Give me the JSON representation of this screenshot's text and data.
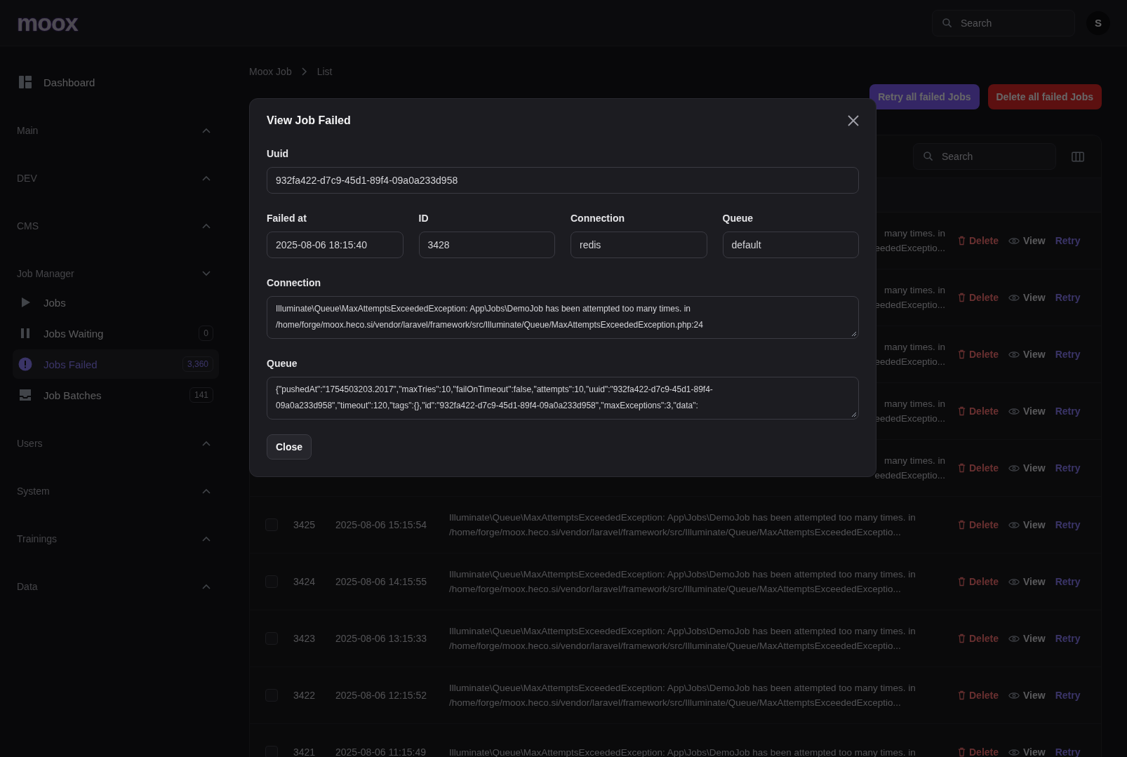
{
  "topbar": {
    "logo": "moox",
    "search": {
      "placeholder": "Search"
    },
    "avatar": "S"
  },
  "sidebar": {
    "items": [
      {
        "kind": "link",
        "label": "Dashboard",
        "selected": false
      },
      {
        "kind": "group",
        "label": "Main",
        "expanded": false
      },
      {
        "kind": "group",
        "label": "DEV",
        "expanded": false
      },
      {
        "kind": "group",
        "label": "CMS",
        "expanded": false
      },
      {
        "kind": "group",
        "label": "Job Manager",
        "expanded": true,
        "children": [
          {
            "label": "Jobs",
            "selected": false
          },
          {
            "label": "Jobs Waiting",
            "badge": "0",
            "selected": false
          },
          {
            "label": "Jobs Failed",
            "badge": "3,360",
            "selected": true
          },
          {
            "label": "Job Batches",
            "badge": "141",
            "selected": false
          }
        ]
      },
      {
        "kind": "group",
        "label": "Users",
        "expanded": false
      },
      {
        "kind": "group",
        "label": "System",
        "expanded": false
      },
      {
        "kind": "group",
        "label": "Trainings",
        "expanded": false
      },
      {
        "kind": "group",
        "label": "Data",
        "expanded": false
      }
    ]
  },
  "breadcrumbs": [
    "Moox Job",
    "List"
  ],
  "header_actions": [
    {
      "label": "Retry all failed Jobs",
      "kind": "primary"
    },
    {
      "label": "Delete all failed Jobs",
      "kind": "danger"
    }
  ],
  "table": {
    "search": {
      "placeholder": "Search"
    },
    "rows": [
      {
        "message": [
          "many times. in",
          "eededExceptio..."
        ],
        "actions": [
          {
            "label": "Delete",
            "kind": "delete"
          },
          {
            "label": "View",
            "kind": "view"
          },
          {
            "label": "Retry",
            "kind": "retry"
          }
        ]
      },
      {
        "message": [
          "many times. in",
          "eededExceptio..."
        ],
        "actions": [
          {
            "label": "Delete",
            "kind": "delete"
          },
          {
            "label": "View",
            "kind": "view"
          },
          {
            "label": "Retry",
            "kind": "retry"
          }
        ]
      },
      {
        "message": [
          "many times. in",
          "eededExceptio..."
        ],
        "actions": [
          {
            "label": "Delete",
            "kind": "delete"
          },
          {
            "label": "View",
            "kind": "view"
          },
          {
            "label": "Retry",
            "kind": "retry"
          }
        ]
      },
      {
        "message": [
          "many times. in",
          "eededExceptio..."
        ],
        "actions": [
          {
            "label": "Delete",
            "kind": "delete"
          },
          {
            "label": "View",
            "kind": "view"
          },
          {
            "label": "Retry",
            "kind": "retry"
          }
        ]
      },
      {
        "message": [
          "many times. in",
          "eededExceptio..."
        ],
        "actions": [
          {
            "label": "Delete",
            "kind": "delete"
          },
          {
            "label": "View",
            "kind": "view"
          },
          {
            "label": "Retry",
            "kind": "retry"
          }
        ]
      },
      {
        "selected": false,
        "id": "3425",
        "failed_at": "2025-08-06 15:15:54",
        "message": [
          "Illuminate\\Queue\\MaxAttemptsExceededException: App\\Jobs\\DemoJob has been attempted too many times. in",
          "/home/forge/moox.heco.si/vendor/laravel/framework/src/Illuminate/Queue/MaxAttemptsExceededExceptio..."
        ],
        "actions": [
          {
            "label": "Delete",
            "kind": "delete"
          },
          {
            "label": "View",
            "kind": "view"
          },
          {
            "label": "Retry",
            "kind": "retry"
          }
        ]
      },
      {
        "selected": false,
        "id": "3424",
        "failed_at": "2025-08-06 14:15:55",
        "message": [
          "Illuminate\\Queue\\MaxAttemptsExceededException: App\\Jobs\\DemoJob has been attempted too many times. in",
          "/home/forge/moox.heco.si/vendor/laravel/framework/src/Illuminate/Queue/MaxAttemptsExceededExceptio..."
        ],
        "actions": [
          {
            "label": "Delete",
            "kind": "delete"
          },
          {
            "label": "View",
            "kind": "view"
          },
          {
            "label": "Retry",
            "kind": "retry"
          }
        ]
      },
      {
        "selected": false,
        "id": "3423",
        "failed_at": "2025-08-06 13:15:33",
        "message": [
          "Illuminate\\Queue\\MaxAttemptsExceededException: App\\Jobs\\DemoJob has been attempted too many times. in",
          "/home/forge/moox.heco.si/vendor/laravel/framework/src/Illuminate/Queue/MaxAttemptsExceededExceptio..."
        ],
        "actions": [
          {
            "label": "Delete",
            "kind": "delete"
          },
          {
            "label": "View",
            "kind": "view"
          },
          {
            "label": "Retry",
            "kind": "retry"
          }
        ]
      },
      {
        "selected": false,
        "id": "3422",
        "failed_at": "2025-08-06 12:15:52",
        "message": [
          "Illuminate\\Queue\\MaxAttemptsExceededException: App\\Jobs\\DemoJob has been attempted too many times. in",
          "/home/forge/moox.heco.si/vendor/laravel/framework/src/Illuminate/Queue/MaxAttemptsExceededExceptio..."
        ],
        "actions": [
          {
            "label": "Delete",
            "kind": "delete"
          },
          {
            "label": "View",
            "kind": "view"
          },
          {
            "label": "Retry",
            "kind": "retry"
          }
        ]
      },
      {
        "selected": false,
        "id": "3421",
        "failed_at": "2025-08-06 11:15:49",
        "message": [
          "Illuminate\\Queue\\MaxAttemptsExceededException: App\\Jobs\\DemoJob has been attempted too many times. in"
        ],
        "actions": [
          {
            "label": "Delete",
            "kind": "delete"
          },
          {
            "label": "View",
            "kind": "view"
          },
          {
            "label": "Retry",
            "kind": "retry"
          }
        ]
      }
    ]
  },
  "modal": {
    "title": "View Job Failed",
    "fields": [
      {
        "kind": "wide",
        "label": "Uuid",
        "value": "932fa422-d7c9-45d1-89f4-09a0a233d958"
      },
      {
        "kind": "narrow",
        "label": "Failed at",
        "value": "2025-08-06 18:15:40"
      },
      {
        "kind": "narrow",
        "label": "ID",
        "value": "3428"
      },
      {
        "kind": "narrow",
        "label": "Connection",
        "value": "redis"
      },
      {
        "kind": "narrow",
        "label": "Queue",
        "value": "default"
      },
      {
        "kind": "textarea",
        "label": "Connection",
        "lines": [
          "Illuminate\\Queue\\MaxAttemptsExceededException: App\\Jobs\\DemoJob has been attempted too many times. in",
          "/home/forge/moox.heco.si/vendor/laravel/framework/src/Illuminate/Queue/MaxAttemptsExceededException.php:24"
        ]
      },
      {
        "kind": "textarea",
        "label": "Queue",
        "lines": [
          "{\"pushedAt\":\"1754503203.2017\",\"maxTries\":10,\"failOnTimeout\":false,\"attempts\":10,\"uuid\":\"932fa422-d7c9-45d1-89f4-",
          "09a0a233d958\",\"timeout\":120,\"tags\":{},\"id\":\"932fa422-d7c9-45d1-89f4-09a0a233d958\",\"maxExceptions\":3,\"data\":"
        ]
      }
    ],
    "button": "Close"
  }
}
